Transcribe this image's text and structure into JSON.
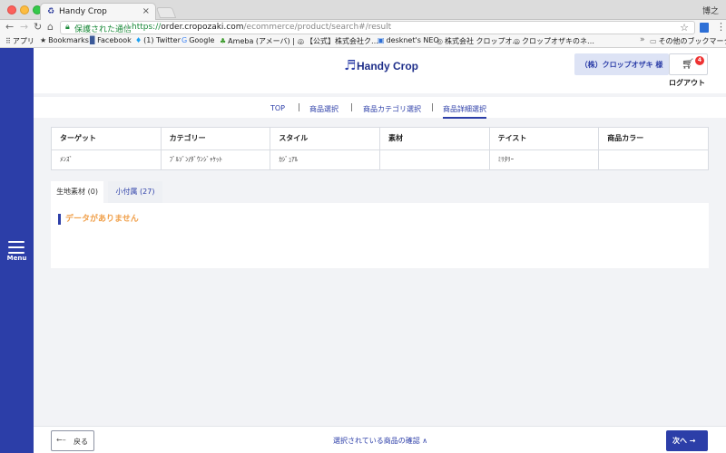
{
  "browser": {
    "tab_title": "Handy Crop",
    "tab_close": "×",
    "profile": "博之",
    "secure_label": "保護された通信",
    "url_scheme": "https://",
    "url_host": "order.cropozaki.com",
    "url_path": "/ecommerce/product/search#/result",
    "bookmarks": [
      {
        "label": "アプリ",
        "icon": "apps-icon"
      },
      {
        "label": "Bookmarks",
        "icon": "star-icon"
      },
      {
        "label": "Facebook",
        "icon": "facebook-icon"
      },
      {
        "label": "(1) Twitter",
        "icon": "twitter-icon"
      },
      {
        "label": "Google",
        "icon": "google-icon"
      },
      {
        "label": "Ameba (アメーバ) | …",
        "icon": "ameba-icon"
      },
      {
        "label": "【公式】株式会社ク…",
        "icon": "globe-icon"
      },
      {
        "label": "desknet's NEO",
        "icon": "desknets-icon"
      },
      {
        "label": "株式会社 クロップオ…",
        "icon": "globe-icon"
      },
      {
        "label": "クロップオザキのネ…",
        "icon": "globe-icon"
      }
    ],
    "bookmarks_more": "»",
    "other_bookmarks": "その他のブックマーク"
  },
  "sidebar": {
    "menu_label": "Menu"
  },
  "header": {
    "logo_text": "Handy Crop",
    "user_name": "（株）クロップオザキ 様",
    "cart_count": "4",
    "logout_label": "ログアウト"
  },
  "breadcrumb": {
    "items": [
      "TOP",
      "商品選択",
      "商品カテゴリ選択",
      "商品詳細選択"
    ],
    "separator": "|"
  },
  "info_table": {
    "headers": [
      "ターゲット",
      "カテゴリー",
      "スタイル",
      "素材",
      "テイスト",
      "商品カラー"
    ],
    "values": [
      "ﾒﾝｽﾞ",
      "ﾌﾞﾙｿﾞﾝ/ﾀﾞｳﾝｼﾞｬｹｯﾄ",
      "ｶｼﾞｭｱﾙ",
      "",
      "ﾐﾘﾀﾘｰ",
      ""
    ]
  },
  "material_tabs": [
    {
      "label": "生地素材 (0)"
    },
    {
      "label": "小付属 (27)"
    }
  ],
  "panel": {
    "empty_message": "データがありません"
  },
  "footer": {
    "back_label": "戻る",
    "confirm_label": "選択されている商品の確認 ∧",
    "next_label": "次へ →"
  },
  "colors": {
    "brand": "#2c3ea8",
    "empty_text": "#f0a04b",
    "badge": "#e33333"
  }
}
